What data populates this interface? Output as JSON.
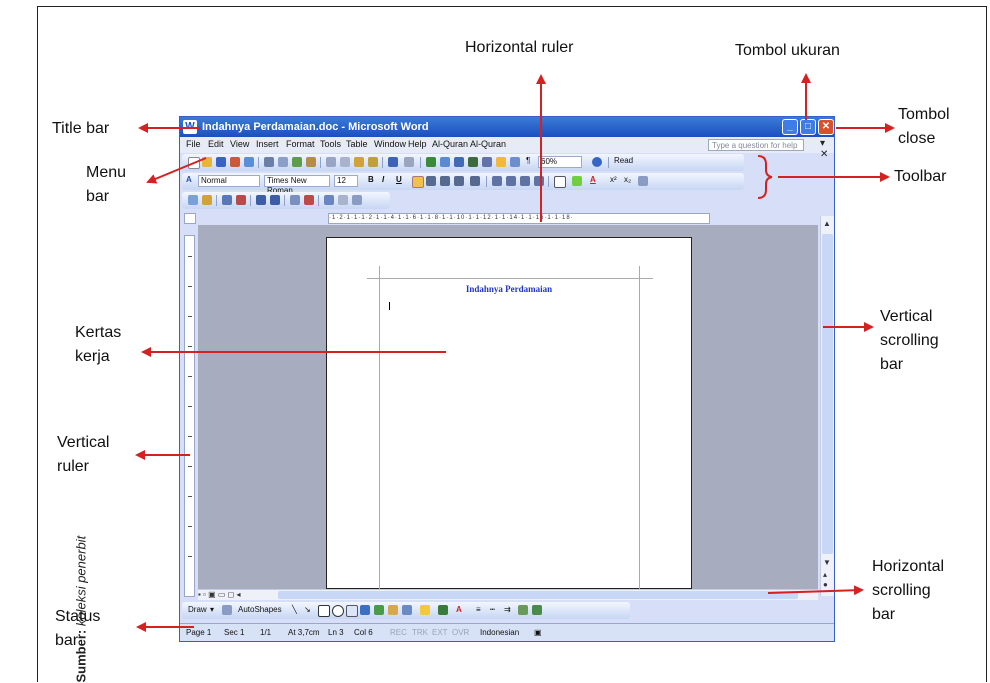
{
  "source": {
    "label": "Sumber:",
    "text": "koleksi penerbit"
  },
  "labels": {
    "horizontal_ruler": "Horizontal ruler",
    "tombol_ukuran": "Tombol ukuran",
    "title_bar": "Title bar",
    "tombol_close_1": "Tombol",
    "tombol_close_2": "close",
    "menu_bar_1": "Menu",
    "menu_bar_2": "bar",
    "toolbar": "Toolbar",
    "kertas_kerja_1": "Kertas",
    "kertas_kerja_2": "kerja",
    "vertical_scrolling_1": "Vertical",
    "vertical_scrolling_2": "scrolling",
    "vertical_scrolling_3": "bar",
    "vertical_ruler_1": "Vertical",
    "vertical_ruler_2": "ruler",
    "horizontal_scrolling_1": "Horizontal",
    "horizontal_scrolling_2": "scrolling",
    "horizontal_scrolling_3": "bar",
    "status_bar_1": "Status",
    "status_bar_2": "bar"
  },
  "window": {
    "title": "Indahnya Perdamaian.doc - Microsoft Word",
    "menu": [
      "File",
      "Edit",
      "View",
      "Insert",
      "Format",
      "Tools",
      "Table",
      "Window",
      "Help",
      "Al-Quran",
      "Al-Quran"
    ],
    "help_placeholder": "Type a question for help",
    "style_value": "Normal",
    "font_value": "Times New Roman",
    "size_value": "12",
    "zoom_value": "60%",
    "read_label": "Read",
    "ruler_text": "·1·2·1·1·1·2·1·1·4·1·1·6·1·1·8·1·1·10·1·1·12·1·1·14·1·1·16·1·1·18·",
    "draw_label": "Draw",
    "autoshapes_label": "AutoShapes",
    "document_title": "Indahnya Perdamaian",
    "status": {
      "page": "Page 1",
      "sec": "Sec 1",
      "of": "1/1",
      "at": "At 3,7cm",
      "ln": "Ln 3",
      "col": "Col 6",
      "rec": "REC",
      "trk": "TRK",
      "ext": "EXT",
      "ovr": "OVR",
      "lang": "Indonesian"
    }
  },
  "colors": {
    "arrow": "#d42121",
    "titlebar": "#1b4fbf",
    "doc_title": "#2334c8"
  }
}
